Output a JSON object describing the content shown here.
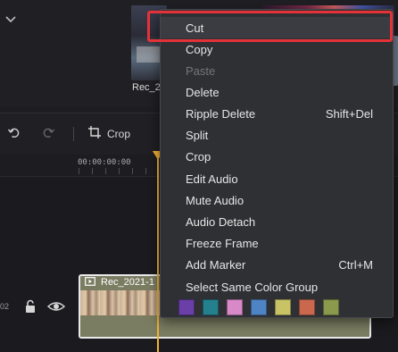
{
  "media": {
    "items": [
      {
        "name": "Rec_2"
      },
      {
        "name": ""
      }
    ]
  },
  "toolbar": {
    "crop_label": "Crop"
  },
  "timeline": {
    "ruler_time": "00:00:00:00",
    "track_number": "02",
    "clip_name": "Rec_2021-1"
  },
  "context_menu": {
    "items": [
      {
        "label": "Cut",
        "shortcut": "",
        "enabled": true
      },
      {
        "label": "Copy",
        "shortcut": "",
        "enabled": true
      },
      {
        "label": "Paste",
        "shortcut": "",
        "enabled": false
      },
      {
        "label": "Delete",
        "shortcut": "",
        "enabled": true
      },
      {
        "label": "Ripple Delete",
        "shortcut": "Shift+Del",
        "enabled": true
      },
      {
        "label": "Split",
        "shortcut": "",
        "enabled": true
      },
      {
        "label": "Crop",
        "shortcut": "",
        "enabled": true
      },
      {
        "label": "Edit Audio",
        "shortcut": "",
        "enabled": true
      },
      {
        "label": "Mute Audio",
        "shortcut": "",
        "enabled": true
      },
      {
        "label": "Audio Detach",
        "shortcut": "",
        "enabled": true
      },
      {
        "label": "Freeze Frame",
        "shortcut": "",
        "enabled": true
      },
      {
        "label": "Add Marker",
        "shortcut": "Ctrl+M",
        "enabled": true
      },
      {
        "label": "Select Same Color Group",
        "shortcut": "",
        "enabled": true
      }
    ],
    "color_swatches": [
      "#6a40a8",
      "#23808c",
      "#d889c7",
      "#4f84c4",
      "#c8c466",
      "#c9684c",
      "#8a9a4c"
    ]
  },
  "colors": {
    "highlight_outline": "#e53238",
    "playhead": "#f2b233"
  }
}
